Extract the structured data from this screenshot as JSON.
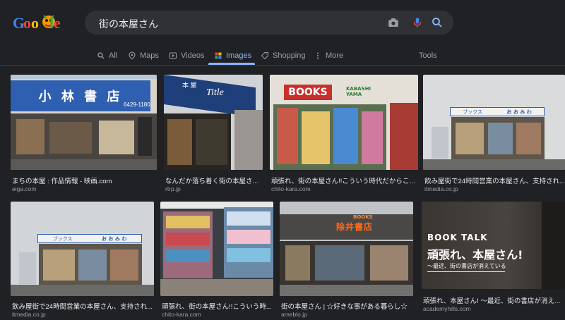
{
  "search": {
    "query": "街の本屋さん"
  },
  "tabs": [
    {
      "label": "All",
      "icon": "search-icon"
    },
    {
      "label": "Maps",
      "icon": "map-pin-icon"
    },
    {
      "label": "Videos",
      "icon": "play-icon"
    },
    {
      "label": "Images",
      "icon": "image-icon",
      "active": true
    },
    {
      "label": "Shopping",
      "icon": "tag-icon"
    },
    {
      "label": "More",
      "icon": "kebab-icon"
    },
    {
      "label": "Tools"
    }
  ],
  "results": [
    {
      "caption": "まちの本屋 : 作品情報 - 映画.com",
      "source": "eiga.com",
      "sign_main": "小 林 書 店",
      "sign_sub": "6429-1180"
    },
    {
      "caption": "なんだか落ち着く街の本屋さ...",
      "source": "rtrp.jp",
      "sign_main": "Title",
      "sign_sub": "本 屋"
    },
    {
      "caption": "頑張れ、街の本屋さん!!こういう時代だからこそ...",
      "source": "chito-kara.com",
      "sign_main": "BOOKS",
      "sign_sub": "KABASHI YAMA"
    },
    {
      "caption": "飲み屋街で24時間営業の本屋さん、支持され...",
      "source": "itmedia.co.jp",
      "sign_main": "ブックス",
      "sign_sub": "お お み わ"
    },
    {
      "caption": "飲み屋街で24時間営業の本屋さん、支持され...",
      "source": "itmedia.co.jp",
      "sign_main": "ブックス",
      "sign_sub": "お お み わ"
    },
    {
      "caption": "頑張れ、街の本屋さん!!こういう時...",
      "source": "chito-kara.com"
    },
    {
      "caption": "街の本屋さん | ☆好きな事がある暮らし☆",
      "source": "ameblo.jp",
      "sign_main": "除井書店",
      "sign_sub": "BOOKS"
    },
    {
      "caption": "頑張れ、本屋さん! 〜最近、街の書店が消えて...",
      "source": "academyhills.com",
      "sign_main": "BOOK TALK",
      "sign_sub": "頑張れ、本屋さん!",
      "sign_extra": "〜最近、街の書店が消えている"
    }
  ],
  "colors": {
    "accent": "#8ab4f8",
    "background": "#202124",
    "search_bg": "#303134"
  }
}
